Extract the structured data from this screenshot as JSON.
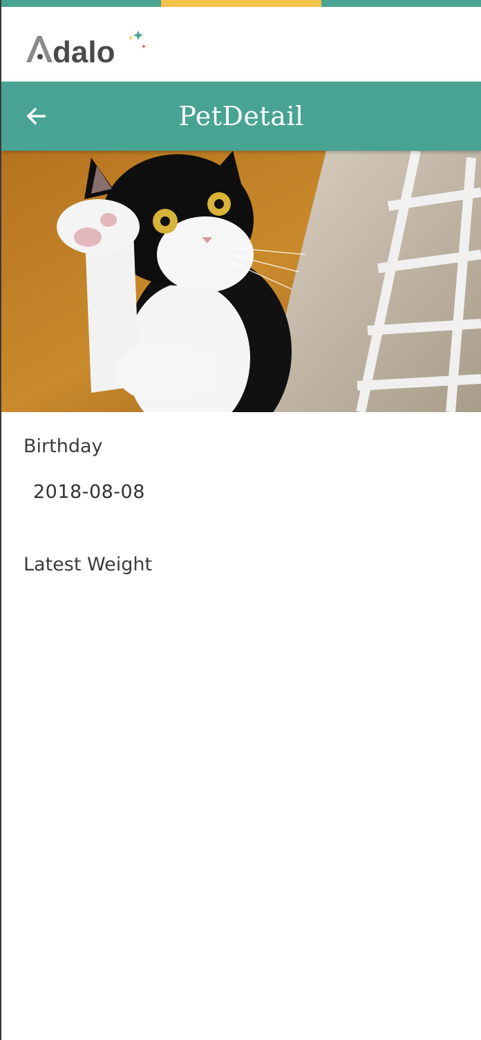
{
  "colors": {
    "brand_teal": "#48a393",
    "brand_yellow": "#f3c24b",
    "logo_gray": "#4a4a4a",
    "text_dark": "#3b3b3b"
  },
  "brand": {
    "logo_text": "Adalo"
  },
  "header": {
    "title": "PetDetail",
    "back_icon": "arrow-left-icon"
  },
  "photo": {
    "subject": "pet-photo"
  },
  "details": {
    "birthday_label": "Birthday",
    "birthday_value": "2018-08-08",
    "weight_label": "Latest Weight"
  }
}
